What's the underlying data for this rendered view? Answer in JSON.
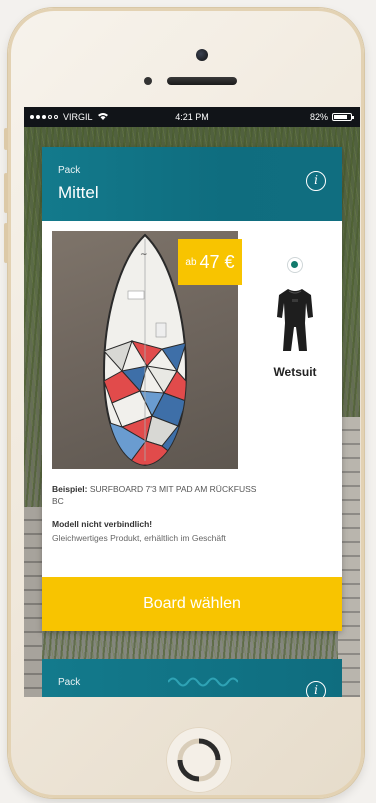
{
  "status_bar": {
    "carrier": "VIRGIL",
    "time": "4:21 PM",
    "battery_text": "82%",
    "battery_level": 0.82
  },
  "card": {
    "pack_label": "Pack",
    "pack_name": "Mittel",
    "price_prefix": "ab",
    "price_value": "47 €",
    "option_label": "Wetsuit",
    "option_selected": true,
    "example_label": "Beispiel:",
    "example_text": "SURFBOARD 7'3 MIT PAD AM RÜCKFUSS BC",
    "note_title": "Modell nicht verbindlich!",
    "note_text": "Gleichwertiges Produkt, erhältlich im Geschäft",
    "cta_label": "Board wählen"
  },
  "next_card": {
    "pack_label": "Pack"
  },
  "colors": {
    "teal": "#137a8c",
    "yellow": "#f8c400",
    "radio_green": "#137a6c"
  },
  "icons": [
    "info-icon",
    "wifi-icon",
    "battery-icon",
    "surfboard-image",
    "wetsuit-image"
  ]
}
